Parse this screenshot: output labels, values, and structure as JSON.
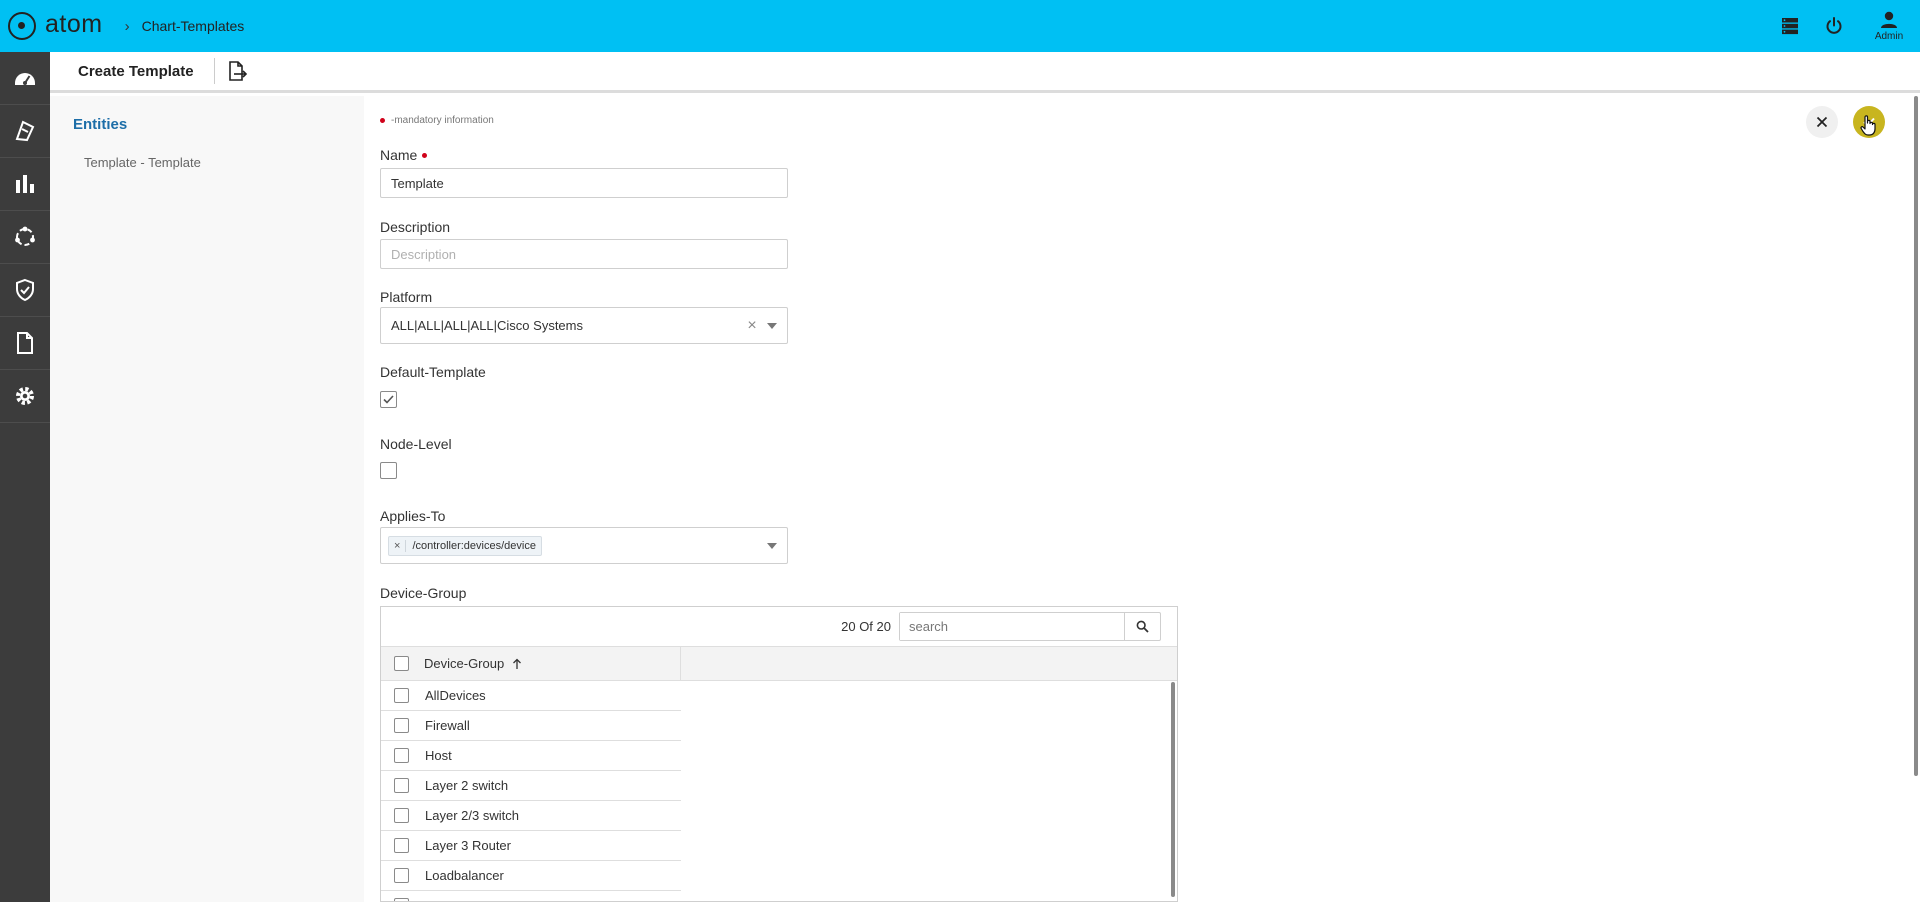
{
  "app": {
    "brand": "atom",
    "breadcrumb_sep": "›",
    "breadcrumb": "Chart-Templates"
  },
  "header": {
    "icons": [
      "server-list-icon",
      "power-icon",
      "user-icon"
    ],
    "user_label": "Admin"
  },
  "rail": {
    "items": [
      "dashboard-icon",
      "devices-icon",
      "bar-chart-icon",
      "topology-icon",
      "shield-icon",
      "document-icon",
      "gear-icon"
    ]
  },
  "toolbar": {
    "title": "Create Template",
    "export_icon": "file-export-icon"
  },
  "entities": {
    "title": "Entities",
    "items": [
      "Template - Template"
    ]
  },
  "form": {
    "mandatory_note": "-mandatory information",
    "name": {
      "label": "Name",
      "value": "Template"
    },
    "description": {
      "label": "Description",
      "value": "",
      "placeholder": "Description"
    },
    "platform": {
      "label": "Platform",
      "value": "ALL|ALL|ALL|ALL|Cisco Systems",
      "clear": "×"
    },
    "default_template": {
      "label": "Default-Template",
      "checked": true
    },
    "node_level": {
      "label": "Node-Level",
      "checked": false
    },
    "applies_to": {
      "label": "Applies-To",
      "chips": [
        {
          "remove": "×",
          "label": "/controller:devices/device"
        }
      ]
    },
    "device_group": {
      "label": "Device-Group",
      "count": "20 Of 20",
      "search_placeholder": "search",
      "column": "Device-Group",
      "rows": [
        "AllDevices",
        "Firewall",
        "Host",
        "Layer 2 switch",
        "Layer 2/3 switch",
        "Layer 3 Router",
        "Loadbalancer"
      ]
    }
  },
  "actions": {
    "close_icon": "close-icon",
    "save_icon": "check-icon"
  },
  "colors": {
    "topbar": "#00c0f3",
    "rail": "#3c3c3c",
    "accent": "#1d6ea8",
    "save": "#c8b51f",
    "required": "#d0021b"
  }
}
